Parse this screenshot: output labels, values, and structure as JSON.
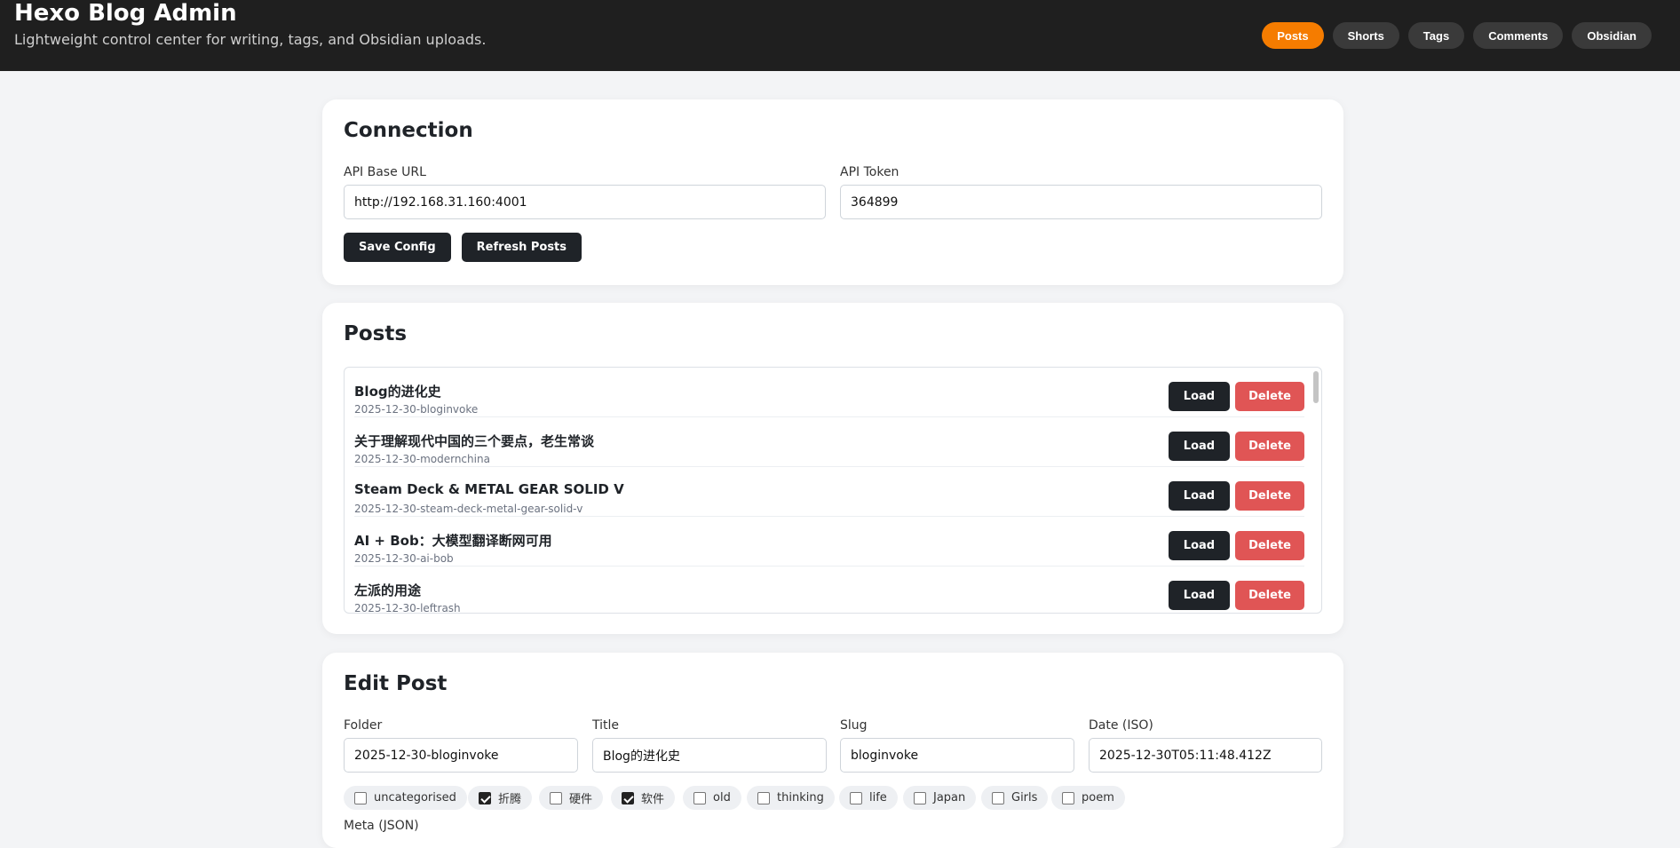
{
  "header": {
    "title": "Hexo Blog Admin",
    "subtitle": "Lightweight control center for writing, tags, and Obsidian uploads.",
    "nav": [
      {
        "label": "Posts",
        "active": true
      },
      {
        "label": "Shorts",
        "active": false
      },
      {
        "label": "Tags",
        "active": false
      },
      {
        "label": "Comments",
        "active": false
      },
      {
        "label": "Obsidian",
        "active": false
      }
    ]
  },
  "connection": {
    "heading": "Connection",
    "api_base_label": "API Base URL",
    "api_base_value": "http://192.168.31.160:4001",
    "api_token_label": "API Token",
    "api_token_value": "364899",
    "save_label": "Save Config",
    "refresh_label": "Refresh Posts"
  },
  "posts": {
    "heading": "Posts",
    "load_label": "Load",
    "delete_label": "Delete",
    "items": [
      {
        "title": "Blog的进化史",
        "slug": "2025-12-30-bloginvoke"
      },
      {
        "title": "关于理解现代中国的三个要点，老生常谈",
        "slug": "2025-12-30-modernchina"
      },
      {
        "title": "Steam Deck & METAL GEAR SOLID V",
        "slug": "2025-12-30-steam-deck-metal-gear-solid-v"
      },
      {
        "title": "AI + Bob：大模型翻译断网可用",
        "slug": "2025-12-30-ai-bob"
      },
      {
        "title": "左派的用途",
        "slug": "2025-12-30-leftrash"
      }
    ]
  },
  "edit": {
    "heading": "Edit Post",
    "folder_label": "Folder",
    "folder_value": "2025-12-30-bloginvoke",
    "title_label": "Title",
    "title_value": "Blog的进化史",
    "slug_label": "Slug",
    "slug_value": "bloginvoke",
    "date_label": "Date (ISO)",
    "date_value": "2025-12-30T05:11:48.412Z",
    "tags": [
      {
        "label": "uncategorised",
        "checked": false
      },
      {
        "label": "折腾",
        "checked": true
      },
      {
        "label": "硬件",
        "checked": false
      },
      {
        "label": "软件",
        "checked": true
      },
      {
        "label": "old",
        "checked": false
      },
      {
        "label": "thinking",
        "checked": false
      },
      {
        "label": "life",
        "checked": false
      },
      {
        "label": "Japan",
        "checked": false
      },
      {
        "label": "Girls",
        "checked": false
      },
      {
        "label": "poem",
        "checked": false
      }
    ],
    "meta_label": "Meta (JSON)"
  },
  "colors": {
    "topbar": "#1f1f1f",
    "accent": "#f57c00",
    "dark_button": "#1f2328",
    "danger": "#e05555",
    "page_bg": "#f3f4f6"
  }
}
